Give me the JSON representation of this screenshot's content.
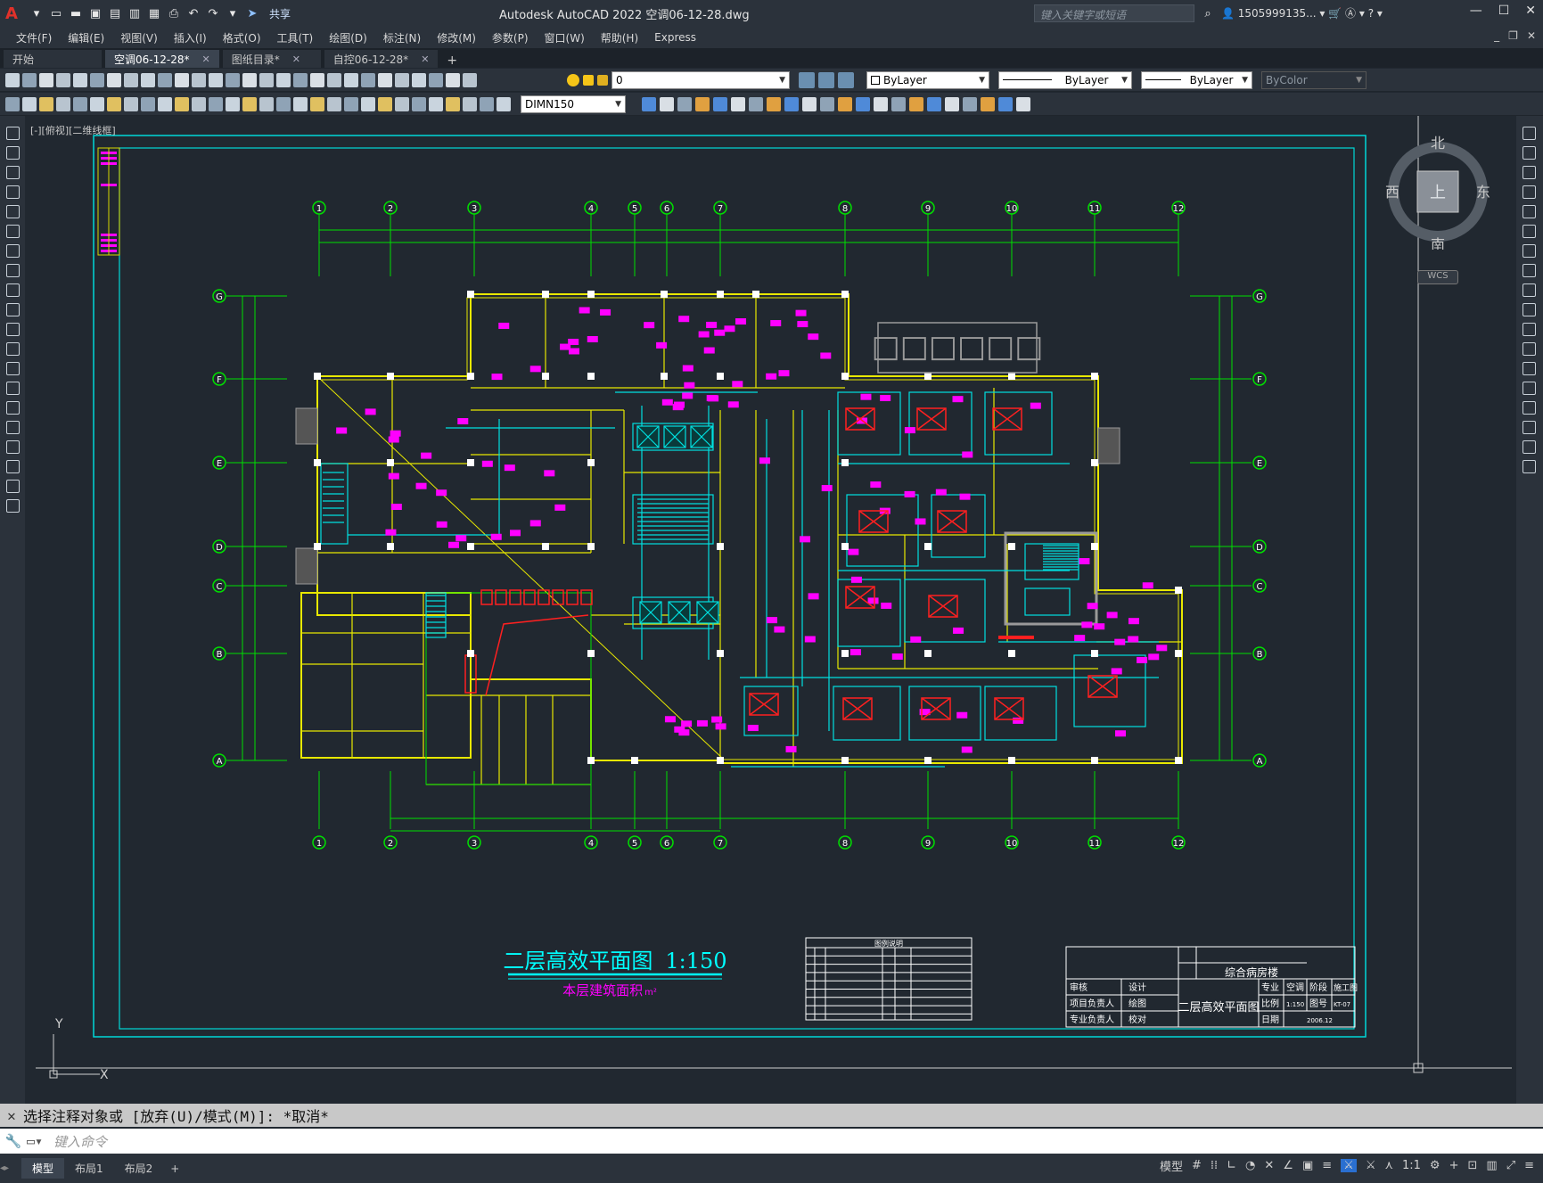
{
  "app": {
    "window_title": "Autodesk AutoCAD 2022    空调06-12-28.dwg",
    "share_label": "共享",
    "search_placeholder": "键入关键字或短语",
    "user": "1505999135...",
    "logo": "A"
  },
  "menu": [
    "文件(F)",
    "编辑(E)",
    "视图(V)",
    "插入(I)",
    "格式(O)",
    "工具(T)",
    "绘图(D)",
    "标注(N)",
    "修改(M)",
    "参数(P)",
    "窗口(W)",
    "帮助(H)",
    "Express"
  ],
  "tabs": [
    {
      "label": "开始",
      "active": false,
      "closable": false
    },
    {
      "label": "空调06-12-28*",
      "active": true,
      "closable": true
    },
    {
      "label": "图纸目录*",
      "active": false,
      "closable": true
    },
    {
      "label": "自控06-12-28*",
      "active": false,
      "closable": true
    }
  ],
  "properties": {
    "layer": "0",
    "color": "ByLayer",
    "linetype": "ByLayer",
    "lineweight": "ByLayer",
    "plotstyle": "ByColor",
    "dimstyle": "DIMN150"
  },
  "viewport_label": "[-][俯视][二维线框]",
  "compass": {
    "north": "北",
    "south": "南",
    "east": "东",
    "west": "西",
    "top": "上",
    "wcs": "WCS"
  },
  "drawing": {
    "title": "二层高效平面图",
    "scale": "1:150",
    "subtitle": "本层建筑面积",
    "subtitle_unit": "m²",
    "stamp_box": "□□□□□□",
    "columns": [
      "1",
      "2",
      "3",
      "4",
      "5",
      "6",
      "7",
      "8",
      "9",
      "10",
      "11",
      "12"
    ],
    "rows": [
      "G",
      "F",
      "E",
      "D",
      "C",
      "B",
      "A"
    ],
    "legend_title": "图例说明",
    "titleblock": {
      "project": "综合病房楼",
      "sheet_name": "二层高效平面图",
      "discipline_label": "专业",
      "discipline": "空调",
      "stage_label": "阶段",
      "stage": "施工图",
      "scale_label": "比例",
      "scale": "1:150",
      "sheet_no_label": "图号",
      "sheet_no": "KT-07",
      "date_label": "日期",
      "date": "2006.12",
      "roles": [
        "审核",
        "项目负责人",
        "专业负责人"
      ],
      "roles2": [
        "设计",
        "绘图",
        "校对"
      ]
    }
  },
  "command": {
    "history": "选择注释对象或 [放弃(U)/模式(M)]: *取消*",
    "placeholder": "键入命令"
  },
  "layout_tabs": [
    {
      "label": "模型",
      "active": true
    },
    {
      "label": "布局1",
      "active": false
    },
    {
      "label": "布局2",
      "active": false
    }
  ],
  "status": {
    "mode": "模型",
    "scale": "1:1"
  }
}
